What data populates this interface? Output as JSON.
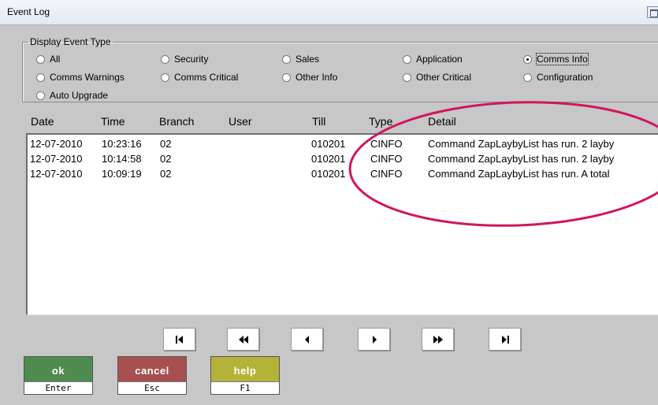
{
  "window": {
    "title": "Event Log"
  },
  "filter": {
    "legend": "Display Event Type",
    "options": [
      {
        "label": "All",
        "checked": false
      },
      {
        "label": "Security",
        "checked": false
      },
      {
        "label": "Sales",
        "checked": false
      },
      {
        "label": "Application",
        "checked": false
      },
      {
        "label": "Comms Info",
        "checked": true
      },
      {
        "label": "Comms Warnings",
        "checked": false
      },
      {
        "label": "Comms Critical",
        "checked": false
      },
      {
        "label": "Other Info",
        "checked": false
      },
      {
        "label": "Other Critical",
        "checked": false
      },
      {
        "label": "Configuration",
        "checked": false
      },
      {
        "label": "Auto Upgrade",
        "checked": false
      }
    ]
  },
  "log": {
    "columns": [
      "Date",
      "Time",
      "Branch",
      "User",
      "Till",
      "Type",
      "Detail"
    ],
    "rows": [
      {
        "date": "12-07-2010",
        "time": "10:23:16",
        "branch": "02",
        "user": "",
        "till": "010201",
        "type": "CINFO",
        "detail": "Command ZapLaybyList has run. 2 layby"
      },
      {
        "date": "12-07-2010",
        "time": "10:14:58",
        "branch": "02",
        "user": "",
        "till": "010201",
        "type": "CINFO",
        "detail": "Command ZapLaybyList has run. 2 layby"
      },
      {
        "date": "12-07-2010",
        "time": "10:09:19",
        "branch": "02",
        "user": "",
        "till": "010201",
        "type": "CINFO",
        "detail": "Command ZapLaybyList has run. A total"
      }
    ]
  },
  "navigation": [
    "first-record-icon",
    "previous-page-icon",
    "previous-record-icon",
    "next-record-icon",
    "next-page-icon",
    "last-record-icon"
  ],
  "function_buttons": {
    "ok": {
      "label": "ok",
      "key": "Enter",
      "color": "#4f8a4f"
    },
    "cancel": {
      "label": "cancel",
      "key": "Esc",
      "color": "#a85050"
    },
    "help": {
      "label": "help",
      "key": "F1",
      "color": "#b5b23a"
    }
  },
  "annotation": {
    "color": "#d01660"
  }
}
